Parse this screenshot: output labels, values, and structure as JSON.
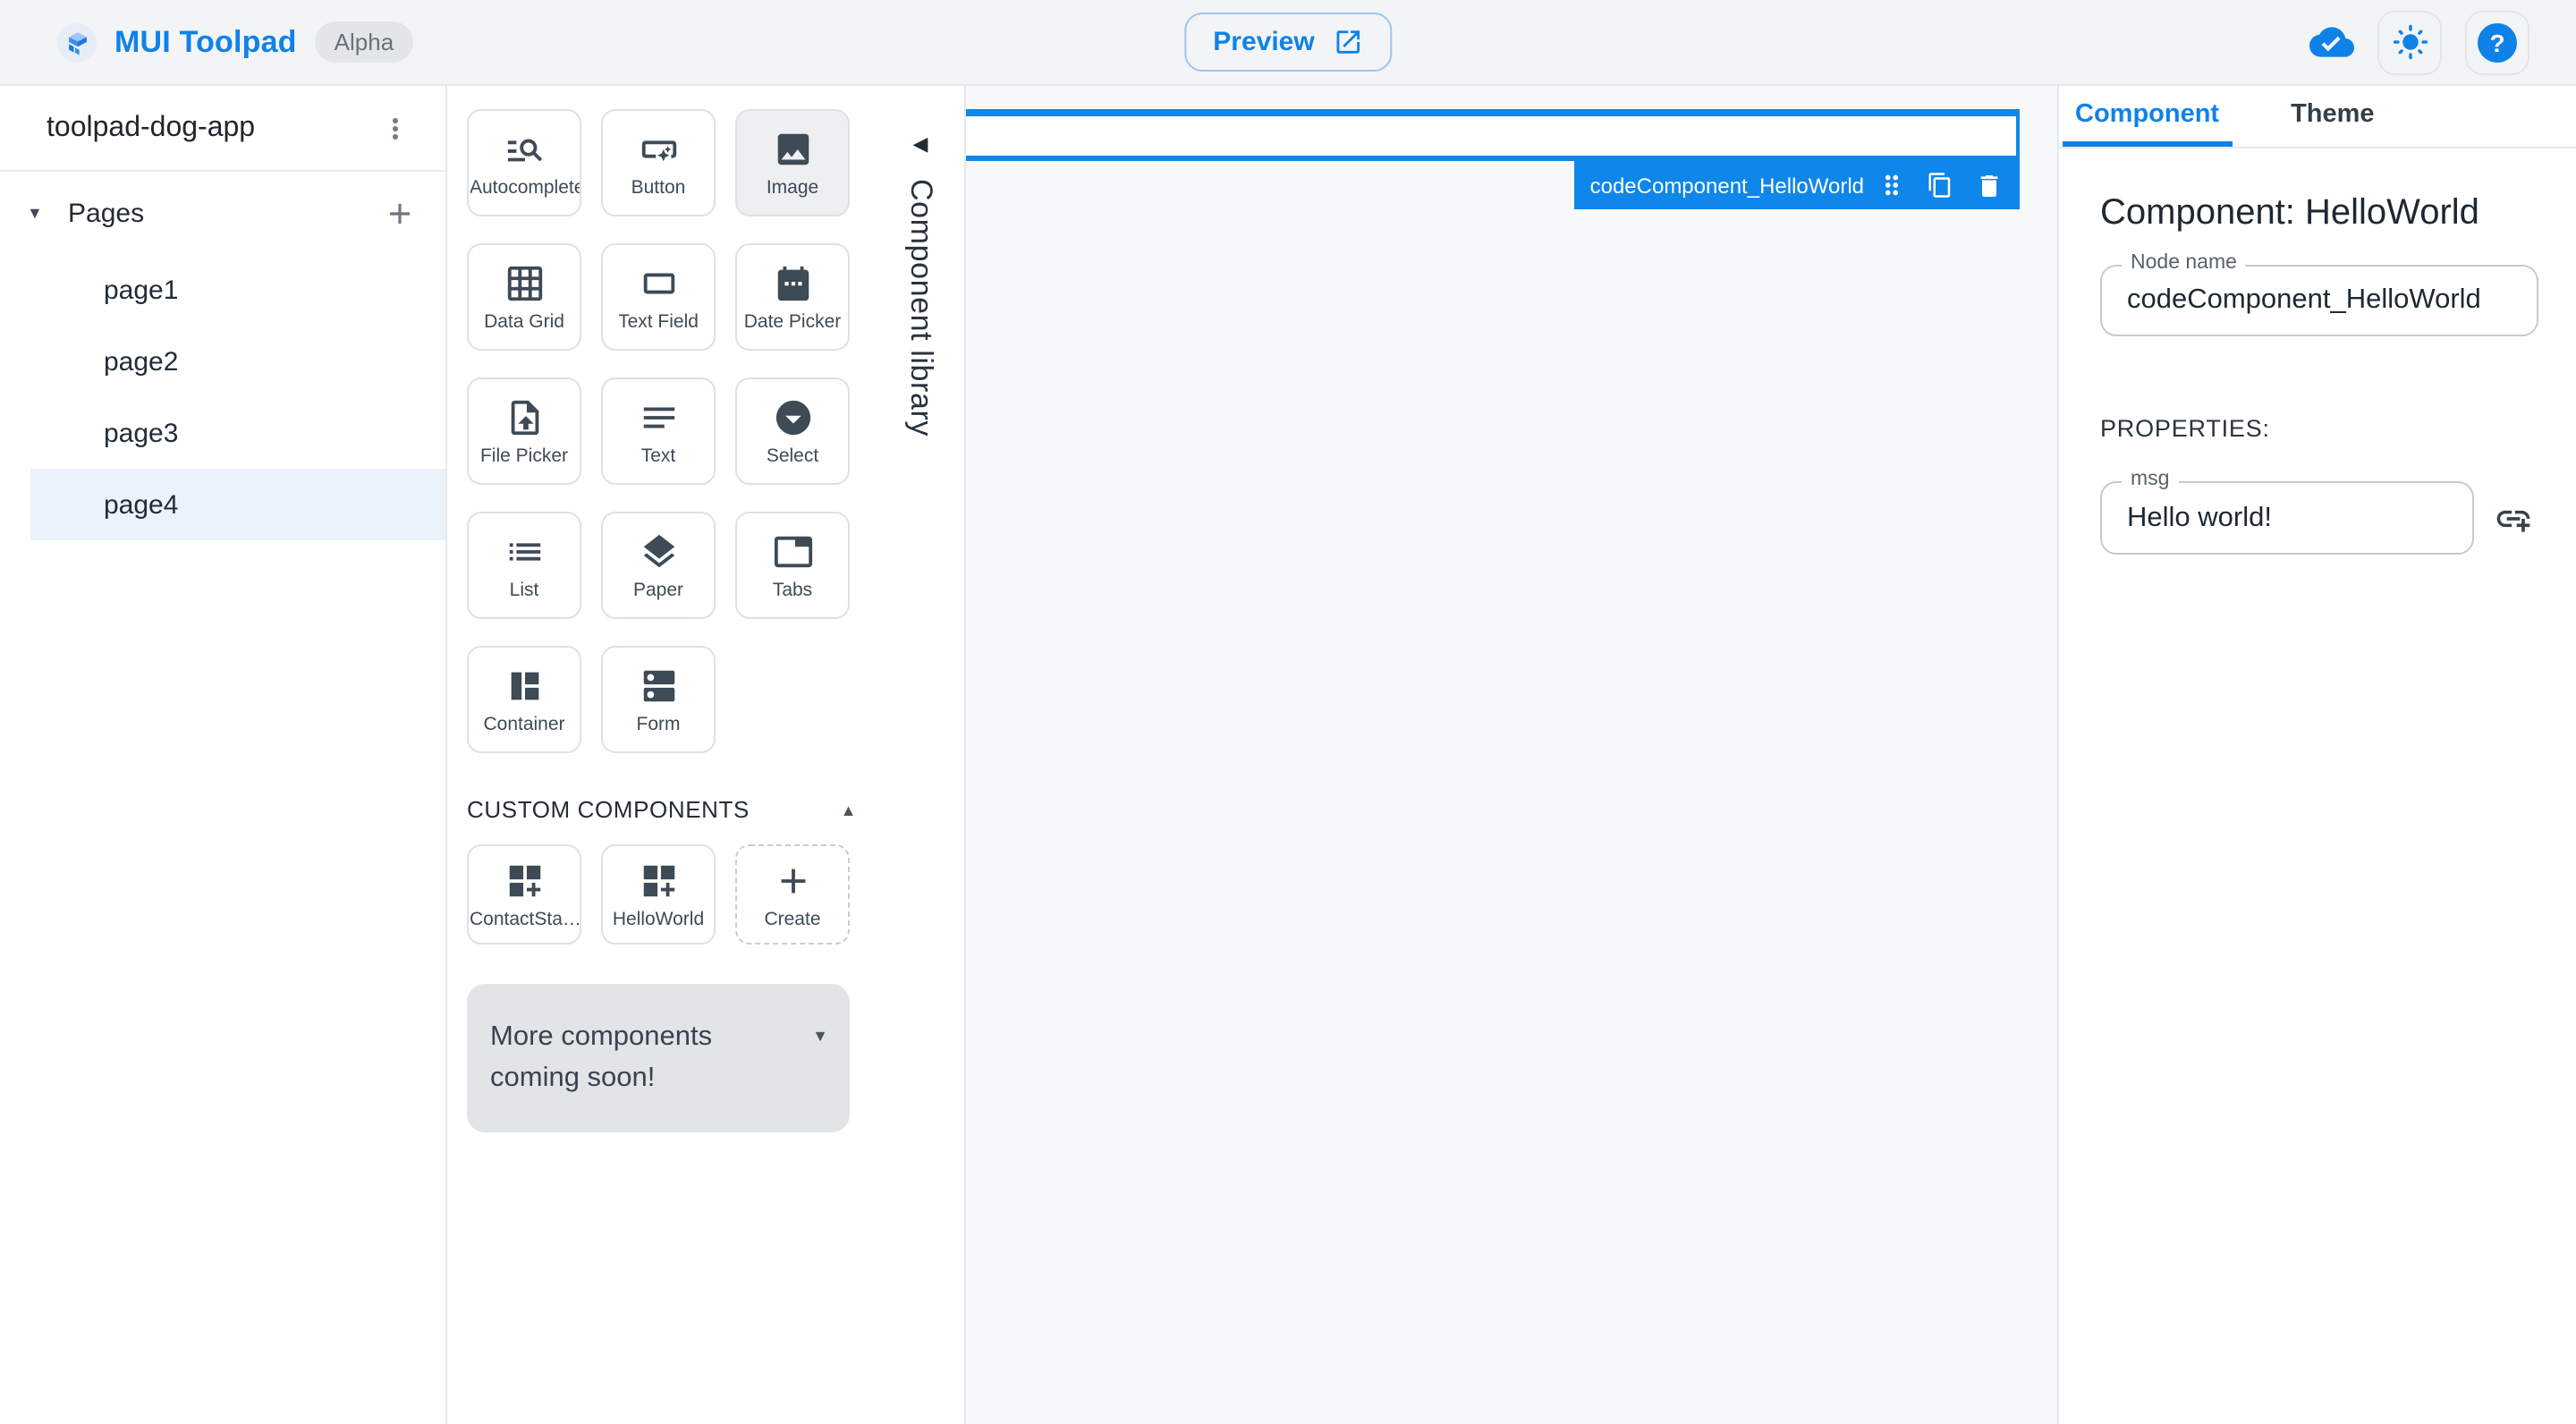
{
  "colors": {
    "accent": "#0f82e8",
    "selection": "#0f86e9",
    "canvas_bg": "#f7f8f9",
    "active_page_bg": "#eaf2fb"
  },
  "topbar": {
    "brand": "MUI Toolpad",
    "badge": "Alpha",
    "preview_label": "Preview",
    "icons": [
      "mui-logo-icon",
      "open-in-new-icon",
      "cloud-done-icon",
      "light-mode-icon",
      "help-icon"
    ],
    "help_glyph": "?"
  },
  "sidebar": {
    "project_name": "toolpad-dog-app",
    "pages_label": "Pages",
    "pages": [
      {
        "label": "page1"
      },
      {
        "label": "page2"
      },
      {
        "label": "page3"
      },
      {
        "label": "page4",
        "active": true
      }
    ]
  },
  "library": {
    "panel_title": "Component library",
    "components": [
      {
        "label": "Autocomplete",
        "icon": "autocomplete-icon"
      },
      {
        "label": "Button",
        "icon": "button-icon"
      },
      {
        "label": "Image",
        "icon": "image-icon",
        "active": true
      },
      {
        "label": "Data Grid",
        "icon": "data-grid-icon"
      },
      {
        "label": "Text Field",
        "icon": "text-field-icon"
      },
      {
        "label": "Date Picker",
        "icon": "date-picker-icon"
      },
      {
        "label": "File Picker",
        "icon": "file-picker-icon"
      },
      {
        "label": "Text",
        "icon": "text-icon"
      },
      {
        "label": "Select",
        "icon": "select-icon"
      },
      {
        "label": "List",
        "icon": "list-icon"
      },
      {
        "label": "Paper",
        "icon": "paper-icon"
      },
      {
        "label": "Tabs",
        "icon": "tabs-icon"
      },
      {
        "label": "Container",
        "icon": "container-icon"
      },
      {
        "label": "Form",
        "icon": "form-icon"
      }
    ],
    "custom_section_label": "CUSTOM COMPONENTS",
    "custom_components": [
      {
        "label": "ContactSta…",
        "icon": "custom-component-icon"
      },
      {
        "label": "HelloWorld",
        "icon": "custom-component-icon"
      },
      {
        "label": "Create",
        "icon": "add-icon",
        "dashed": true
      }
    ],
    "banner_text": "More components coming soon!"
  },
  "canvas": {
    "selected_node_label": "codeComponent_HelloWorld"
  },
  "inspector": {
    "tabs": [
      {
        "label": "Component",
        "active": true
      },
      {
        "label": "Theme"
      }
    ],
    "heading": "Component: HelloWorld",
    "node_name_field": {
      "label": "Node name",
      "value": "codeComponent_HelloWorld"
    },
    "properties_label": "PROPERTIES:",
    "prop_fields": [
      {
        "label": "msg",
        "value": "Hello world!"
      }
    ]
  }
}
